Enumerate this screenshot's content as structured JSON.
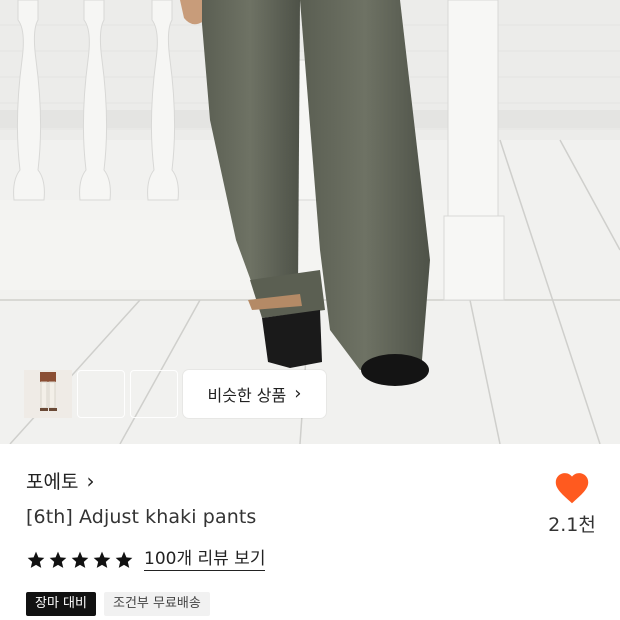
{
  "hero": {
    "similar_button_label": "비슷한 상품",
    "thumbnails": [
      {
        "name": "product-thumbnail-1"
      },
      {
        "name": "product-thumbnail-2"
      },
      {
        "name": "product-thumbnail-3"
      }
    ]
  },
  "product": {
    "brand": "포에토",
    "title": "[6th] Adjust khaki pants",
    "rating_stars": 5,
    "review_link": "100개 리뷰 보기",
    "badges": [
      {
        "label": "장마 대비",
        "style": "dark"
      },
      {
        "label": "조건부 무료배송",
        "style": "light"
      }
    ]
  },
  "like": {
    "count": "2.1천",
    "icon": "heart-icon",
    "color": "#ff5a1f"
  },
  "colors": {
    "accent": "#ff5a1f",
    "text": "#222222",
    "badge_dark": "#111111",
    "badge_light": "#f1f1f1"
  }
}
